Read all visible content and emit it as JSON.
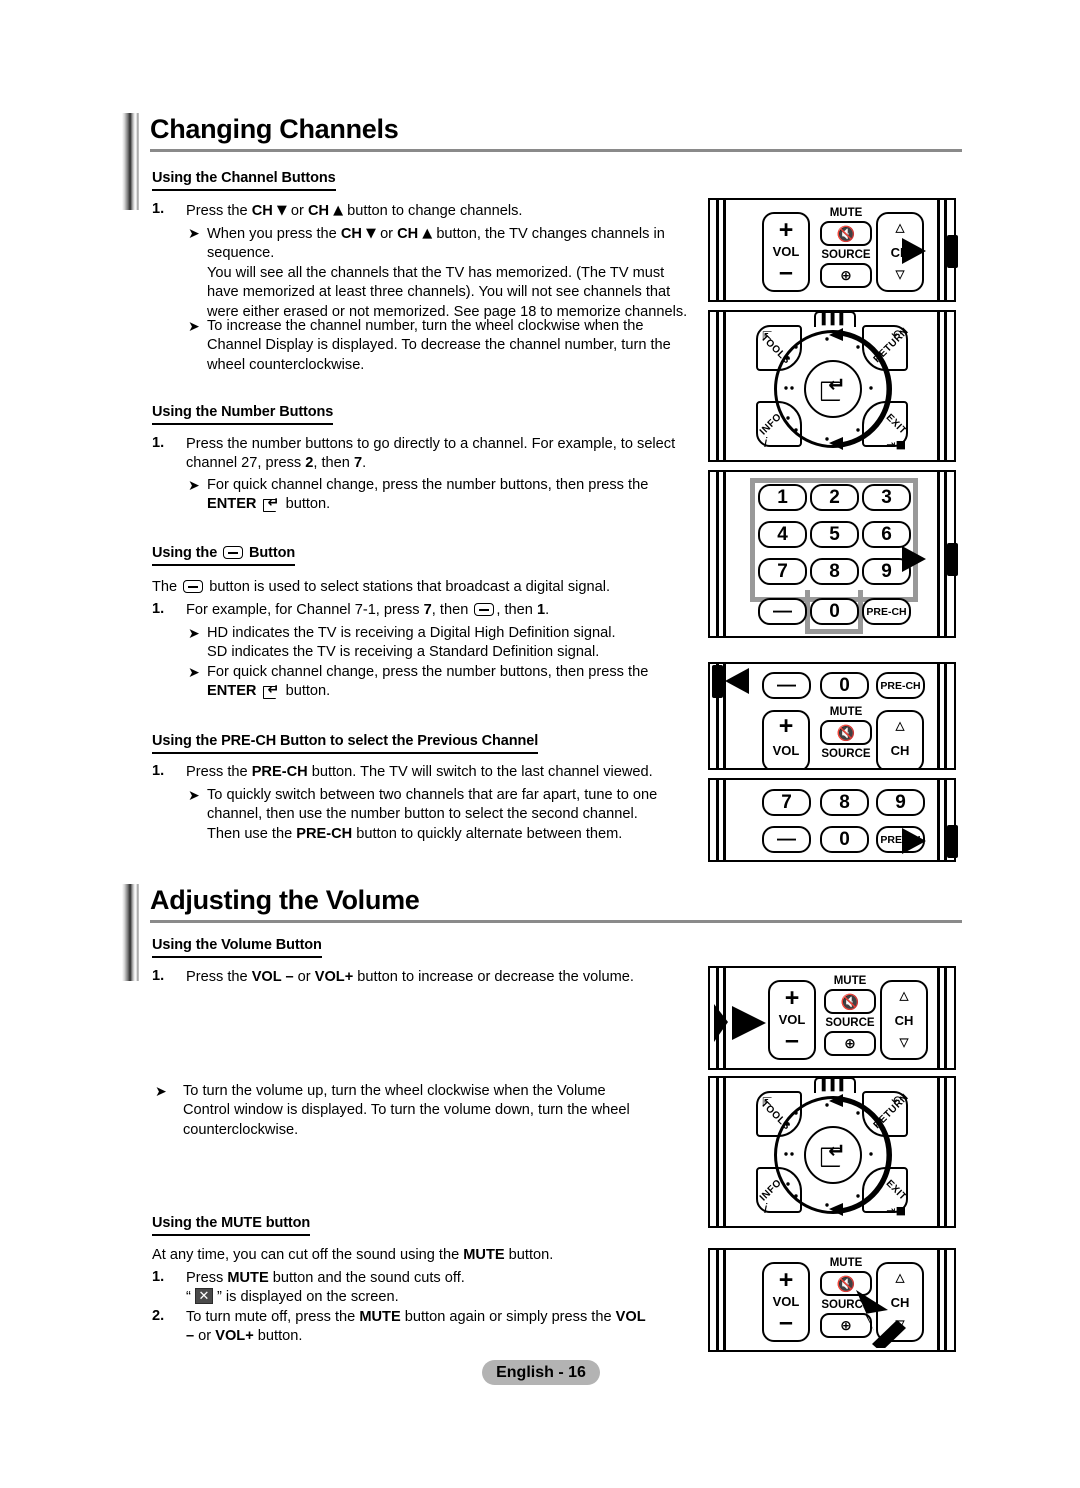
{
  "document": {
    "footer_label": "English - 16"
  },
  "sections": [
    {
      "id": "changing-channels",
      "title": "Changing Channels",
      "subsections": [
        {
          "id": "using-channel-buttons",
          "heading": "Using the Channel Buttons",
          "items": [
            {
              "marker": "1.",
              "text": "Press the CH ∨ or CH ∧ button to change channels."
            },
            {
              "marker": "➢",
              "text": "When you press the CH ∨ or CH ∧ button, the TV changes channels in sequence.\nYou will see all the channels that the TV has memorized. (The TV must have memorized at least three channels). You will not see channels that were either erased or not memorized. See page 18 to memorize channels."
            },
            {
              "marker": "➢",
              "text": "To increase the channel number, turn the wheel clockwise when the Channel Display is displayed. To decrease the channel number, turn the wheel counterclockwise."
            }
          ]
        },
        {
          "id": "using-number-buttons",
          "heading": "Using the Number Buttons",
          "items": [
            {
              "marker": "1.",
              "text": "Press the number buttons to go directly to a channel. For example, to select channel 27, press 2, then 7."
            },
            {
              "marker": "➢",
              "text": "For quick channel change, press the number buttons, then press the ENTER button."
            }
          ]
        },
        {
          "id": "using-dash-button",
          "heading": "Using the — Button",
          "heading_prefix": "Using the",
          "heading_suffix": "Button",
          "items": [
            {
              "marker": "",
              "text": "The — button is used to select stations that broadcast a digital signal."
            },
            {
              "marker": "1.",
              "text": "For example, for Channel 7-1, press 7, then —, then 1."
            },
            {
              "marker": "➢",
              "text": "HD indicates the TV is receiving a Digital High Definition signal.\nSD indicates the TV is receiving a Standard Definition signal."
            },
            {
              "marker": "➢",
              "text": "For quick channel change, press the number buttons, then press the ENTER button."
            }
          ]
        },
        {
          "id": "using-prech-button",
          "heading": "Using the PRE-CH Button to select the Previous Channel",
          "items": [
            {
              "marker": "1.",
              "text": "Press the PRE-CH button. The TV will switch to the last channel viewed."
            },
            {
              "marker": "➢",
              "text": "To quickly switch between two channels that are far apart, tune to one channel, then use the number button to select the second channel. Then use the PRE-CH button to quickly alternate between them."
            }
          ]
        }
      ]
    },
    {
      "id": "adjusting-volume",
      "title": "Adjusting the Volume",
      "subsections": [
        {
          "id": "using-volume-button",
          "heading": "Using the Volume Button",
          "items": [
            {
              "marker": "1.",
              "text": "Press the VOL – or VOL+ button to increase or decrease the volume."
            },
            {
              "marker": "➢",
              "text": "To turn the volume up, turn the wheel clockwise when the Volume Control window is displayed. To turn the volume down, turn the wheel counterclockwise."
            }
          ]
        },
        {
          "id": "using-mute-button",
          "heading": "Using the MUTE button",
          "items": [
            {
              "marker": "",
              "text": "At any time, you can cut off the sound using the MUTE button."
            },
            {
              "marker": "1.",
              "text": "Press MUTE button and the sound cuts off.\n“ ” is displayed on the screen."
            },
            {
              "marker": "2.",
              "text": "To turn mute off, press the MUTE button again or simply press the VOL – or VOL+ button."
            }
          ]
        }
      ]
    }
  ],
  "remote_keys": {
    "vol": "VOL",
    "vol_plus": "+",
    "vol_minus": "–",
    "mute": "MUTE",
    "source": "SOURCE",
    "ch": "CH",
    "ch_up": "∧",
    "ch_down": "∨",
    "tools": "TOOLS",
    "return": "RETURN",
    "info": "INFO",
    "info_glyph": "i",
    "exit": "EXIT",
    "pre_ch": "PRE-CH",
    "zero": "0",
    "dash": "—",
    "keypad": [
      [
        "1",
        "2",
        "3"
      ],
      [
        "4",
        "5",
        "6"
      ],
      [
        "7",
        "8",
        "9"
      ]
    ]
  },
  "diagrams": [
    {
      "id": "diagram-ch-buttons",
      "type": "vol-mute-ch",
      "pointer": "right-at-ch"
    },
    {
      "id": "diagram-wheel-1",
      "type": "wheel",
      "pointer": "none"
    },
    {
      "id": "diagram-keypad-full",
      "type": "keypad-full",
      "pointer": "right-at-keypad"
    },
    {
      "id": "diagram-dash-row",
      "type": "dash-row",
      "pointer": "left-at-dash"
    },
    {
      "id": "diagram-prech-row",
      "type": "prech-row",
      "pointer": "right-at-prech"
    },
    {
      "id": "diagram-vol-buttons",
      "type": "vol-mute-ch",
      "pointer": "left-at-vol"
    },
    {
      "id": "diagram-wheel-2",
      "type": "wheel",
      "pointer": "none"
    },
    {
      "id": "diagram-mute-button",
      "type": "vol-mute-ch",
      "pointer": "diagonal-at-mute"
    }
  ],
  "colors": {
    "rule": "#8a8a8a",
    "footer_pill": "#b3b3b3",
    "keypad_outline": "#999999",
    "ink": "#000000"
  }
}
